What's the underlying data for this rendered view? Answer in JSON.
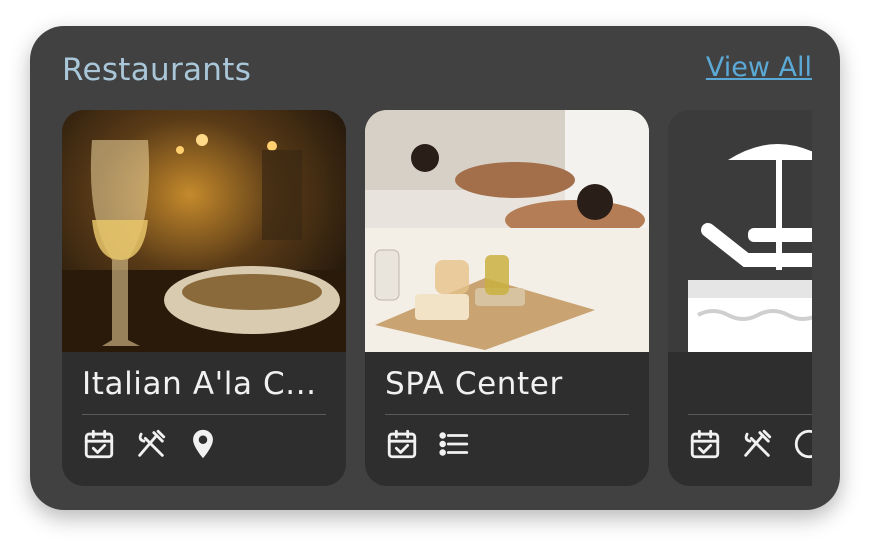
{
  "section": {
    "title": "Restaurants",
    "view_all_label": "View All"
  },
  "cards": [
    {
      "title": "Italian A'la C...",
      "icons": [
        "calendar-check-icon",
        "fork-knife-icon",
        "map-pin-icon"
      ]
    },
    {
      "title": "SPA Center",
      "icons": [
        "calendar-check-icon",
        "list-icon"
      ]
    },
    {
      "title": "",
      "icons": [
        "calendar-check-icon",
        "fork-knife-icon",
        "info-icon"
      ]
    }
  ],
  "colors": {
    "panel_bg": "#414141",
    "card_bg": "#2e2e2e",
    "title_accent": "#a9c7d9",
    "link_accent": "#5aa9d6"
  }
}
